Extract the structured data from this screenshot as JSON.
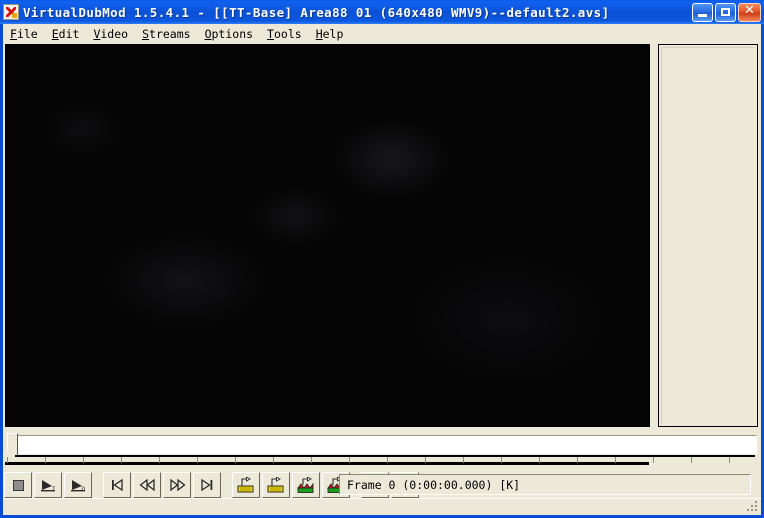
{
  "window": {
    "title": "VirtualDubMod 1.5.4.1 - [[TT-Base] Area88 01 (640x480 WMV9)--default2.avs]",
    "app_icon": "virtualdubmod-icon",
    "titlebar_color": "#0b51d6",
    "face_color": "#ece9d8",
    "controls": {
      "minimize_label": "Minimize",
      "maximize_label": "Maximize",
      "close_label": "Close"
    }
  },
  "menubar": {
    "items": [
      {
        "accel": "F",
        "rest": "ile",
        "name": "file"
      },
      {
        "accel": "E",
        "rest": "dit",
        "name": "edit"
      },
      {
        "accel": "V",
        "rest": "ideo",
        "name": "video"
      },
      {
        "accel": "S",
        "rest": "treams",
        "name": "streams"
      },
      {
        "accel": "O",
        "rest": "ptions",
        "name": "options"
      },
      {
        "accel": "T",
        "rest": "ools",
        "name": "tools"
      },
      {
        "accel": "H",
        "rest": "elp",
        "name": "help"
      }
    ]
  },
  "panes": {
    "input": {
      "name": "input-video-pane",
      "content": "",
      "background": "#040404",
      "resolution": "640x480"
    },
    "output": {
      "name": "output-video-pane",
      "content": "",
      "background": "#ece9d8"
    }
  },
  "position_slider": {
    "name": "position-slider",
    "value": 0,
    "min": 0,
    "max": 100,
    "thumb_position_percent": 0
  },
  "toolbar": {
    "buttons": [
      {
        "name": "stop-button",
        "icon": "stop-icon",
        "tooltip": "Stop"
      },
      {
        "name": "play-input-button",
        "icon": "play-input-icon",
        "tooltip": "Play input video"
      },
      {
        "name": "play-output-button",
        "icon": "play-output-icon",
        "tooltip": "Play output video"
      },
      {
        "name": "go-to-start-button",
        "icon": "skip-to-start-icon",
        "tooltip": "Go to start"
      },
      {
        "name": "step-back-button",
        "icon": "rewind-icon",
        "tooltip": "Backward"
      },
      {
        "name": "step-forward-button",
        "icon": "fast-forward-icon",
        "tooltip": "Forward"
      },
      {
        "name": "go-to-end-button",
        "icon": "skip-to-end-icon",
        "tooltip": "Go to end"
      },
      {
        "name": "prev-keyframe-button",
        "icon": "key-prev-icon",
        "tooltip": "Previous keyframe"
      },
      {
        "name": "next-keyframe-button",
        "icon": "key-next-icon",
        "tooltip": "Next keyframe"
      },
      {
        "name": "prev-scene-button",
        "icon": "scene-prev-icon",
        "tooltip": "Previous scene"
      },
      {
        "name": "next-scene-button",
        "icon": "scene-next-icon",
        "tooltip": "Next scene"
      },
      {
        "name": "mark-in-button",
        "icon": "mark-in-icon",
        "tooltip": "Set selection start"
      },
      {
        "name": "mark-out-button",
        "icon": "mark-out-icon",
        "tooltip": "Set selection end"
      }
    ]
  },
  "status": {
    "frame_text": "Frame 0  (0:00:00.000)  [K]",
    "frame_number": 0,
    "timecode": "0:00:00.000",
    "keyframe_flag": "[K]"
  }
}
